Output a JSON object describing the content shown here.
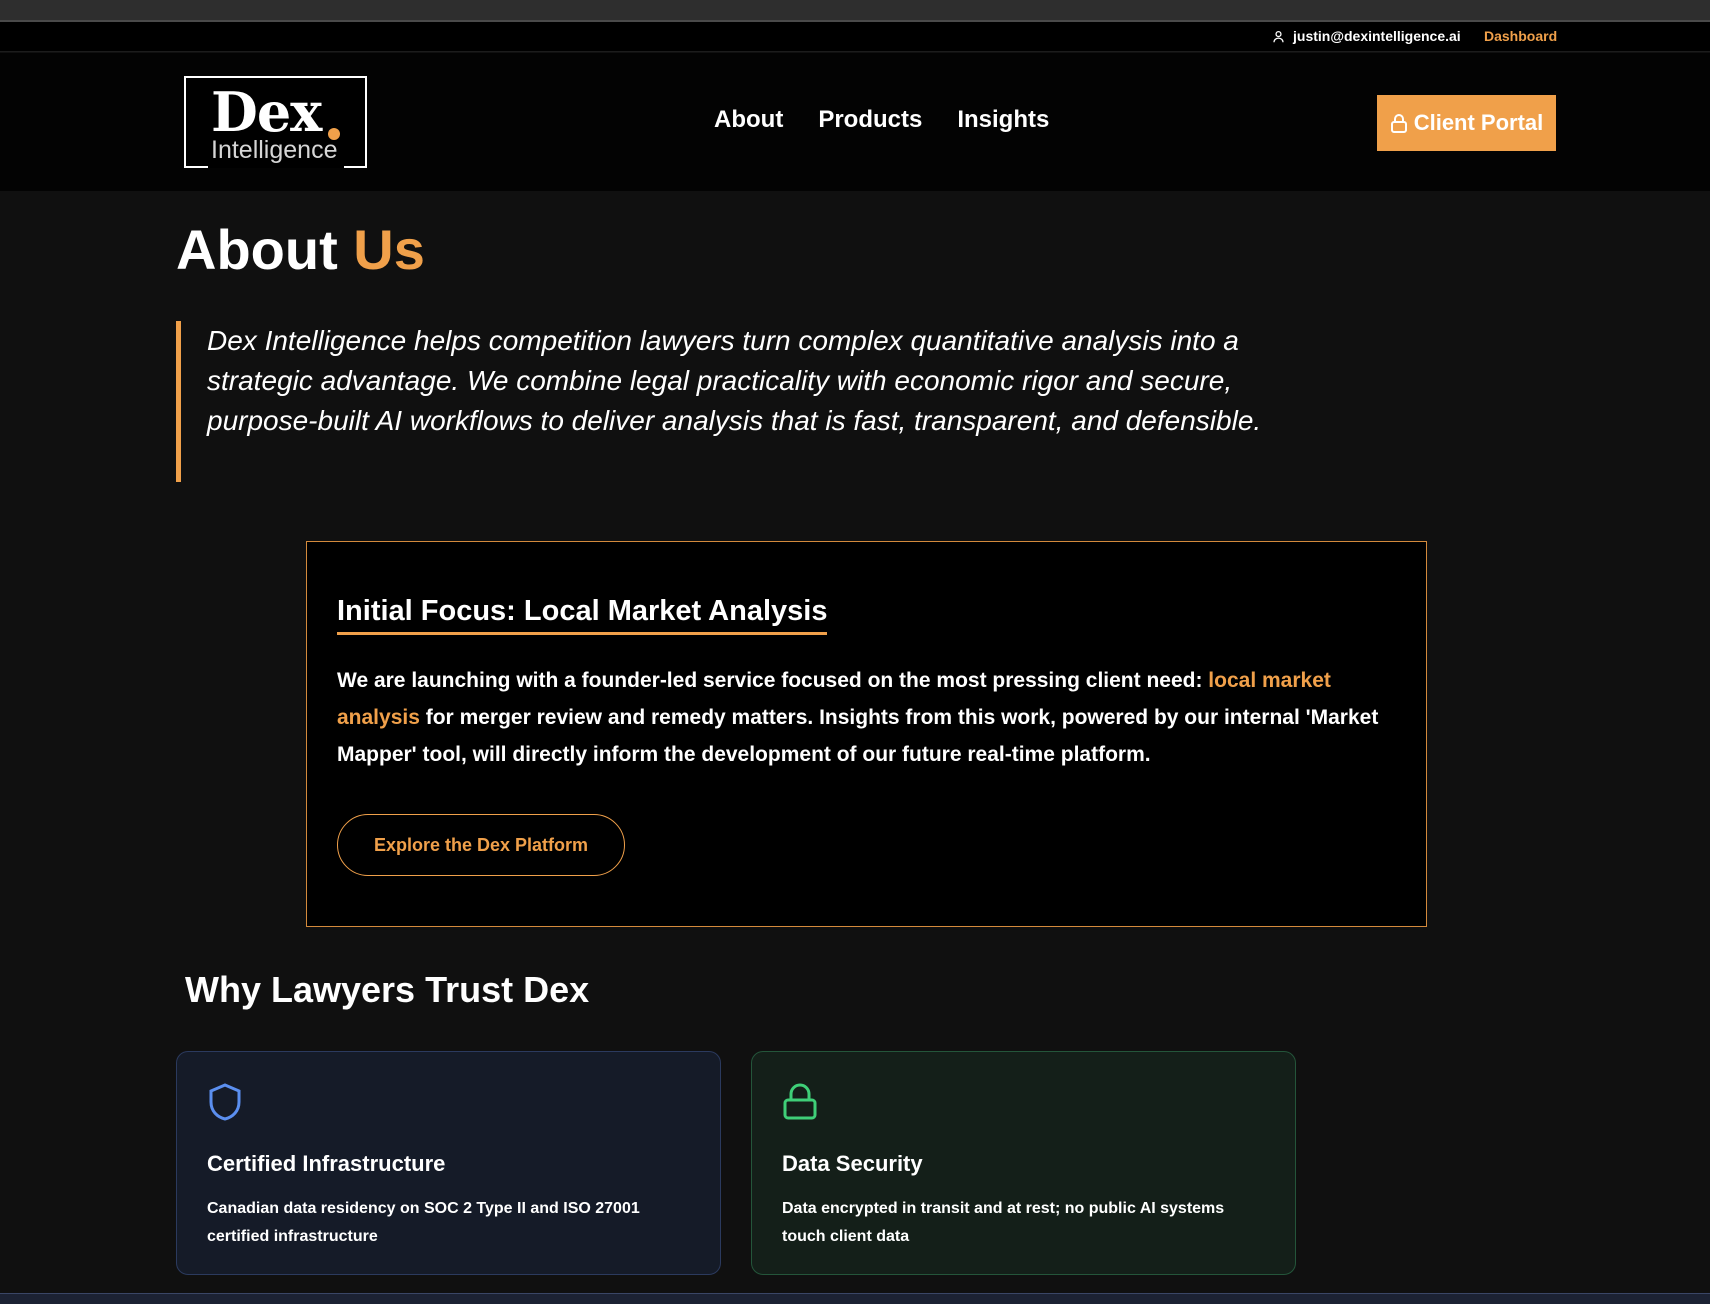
{
  "utility": {
    "user_email": "justin@dexintelligence.ai",
    "dashboard_label": "Dashboard"
  },
  "logo": {
    "name": "Dex",
    "subtitle": "Intelligence"
  },
  "nav": {
    "items": [
      "About",
      "Products",
      "Insights"
    ],
    "portal_label": "Client Portal"
  },
  "hero": {
    "title_main": "About",
    "title_accent": "Us",
    "mission": "Dex Intelligence helps competition lawyers turn complex quantitative analysis into a strategic advantage. We combine legal practicality with economic rigor and secure, purpose-built AI workflows to deliver analysis that is fast, transparent, and defensible."
  },
  "focus": {
    "title": "Initial Focus: Local Market Analysis",
    "body_before": "We are launching with a founder-led service focused on the most pressing client need: ",
    "body_highlight": "local market analysis",
    "body_after": " for merger review and remedy matters. Insights from this work, powered by our internal 'Market Mapper' tool, will directly inform the development of our future real-time platform.",
    "button_label": "Explore the Dex Platform"
  },
  "trust": {
    "title": "Why Lawyers Trust Dex",
    "cards": [
      {
        "icon": "shield-icon",
        "title": "Certified Infrastructure",
        "text": "Canadian data residency on SOC 2 Type II and ISO 27001 certified infrastructure"
      },
      {
        "icon": "lock-icon",
        "title": "Data Security",
        "text": "Data encrypted in transit and at rest; no public AI systems touch client data"
      }
    ]
  },
  "colors": {
    "accent": "#f0a04a",
    "background": "#101010",
    "card_blue_icon": "#5b8ff0",
    "card_green_icon": "#3fcf78"
  }
}
